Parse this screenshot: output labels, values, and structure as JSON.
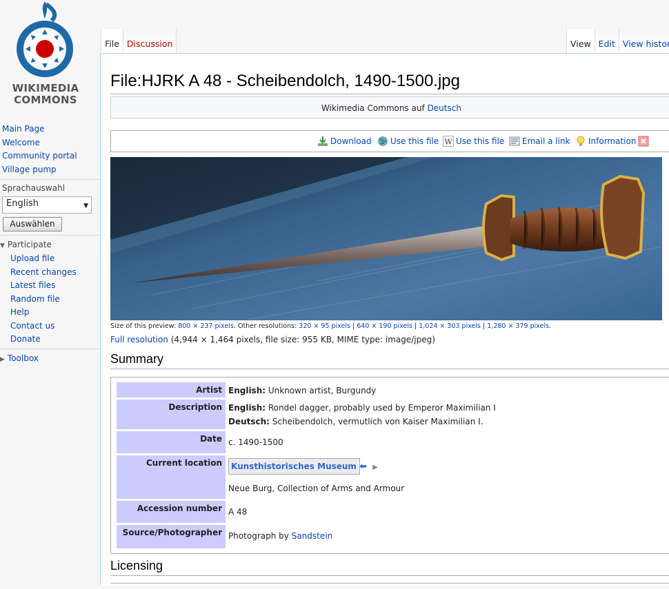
{
  "sidebar": {
    "logo_line1": "WIKIMEDIA",
    "logo_line2": "COMMONS",
    "nav": [
      "Main Page",
      "Welcome",
      "Community portal",
      "Village pump"
    ],
    "language_label": "Sprachauswahl",
    "language_selected": "English",
    "language_button": "Auswählen",
    "participate_label": "Participate",
    "participate_items": [
      "Upload file",
      "Recent changes",
      "Latest files",
      "Random file",
      "Help",
      "Contact us",
      "Donate"
    ],
    "toolbox_label": "Toolbox"
  },
  "tabs": {
    "left": [
      "File",
      "Discussion"
    ],
    "right": [
      "View",
      "Edit",
      "View histor"
    ]
  },
  "page": {
    "title": "File:HJRK A 48 - Scheibendolch, 1490-1500.jpg",
    "commons_prefix": "Wikimedia Commons auf ",
    "commons_link": "Deutsch"
  },
  "toolbar": {
    "download": "Download",
    "use_file_1": "Use this file",
    "use_file_2": "Use this file",
    "email": "Email a link",
    "information": "Information"
  },
  "image_info": {
    "size_prefix": "Size of this preview: ",
    "size_preview": "800 × 237 pixels",
    "other_label": ". Other resolutions: ",
    "res": [
      "320 × 95 pixels",
      "640 × 190 pixels",
      "1,024 × 303 pixels",
      "1,280 × 379 pixels"
    ],
    "full_res_link": "Full resolution",
    "full_res_details": " (4,944 × 1,464 pixels, file size: 955 KB, MIME type: image/jpeg)"
  },
  "summary": {
    "heading": "Summary",
    "artist_label": "Artist",
    "artist_lang": "English:",
    "artist_value": " Unknown artist, Burgundy",
    "description_label": "Description",
    "desc_en_lang": "English:",
    "desc_en": " Rondel dagger, probably used by Emperor Maximilian I",
    "desc_de_lang": "Deutsch:",
    "desc_de": " Scheibendolch, vermutlich von Kaiser Maximilian I.",
    "date_label": "Date",
    "date_value": "c. 1490-1500",
    "location_label": "Current location",
    "museum": "Kunsthistorisches Museum",
    "location_sub": "Neue Burg, Collection of Arms and Armour",
    "accession_label": "Accession number",
    "accession_value": "A 48",
    "source_label": "Source/Photographer",
    "source_prefix": "Photograph by ",
    "source_link": "Sandstein"
  },
  "licensing": {
    "heading": "Licensing"
  },
  "colors": {
    "link": "#0645ad",
    "label_bg": "#ccccff",
    "tab_border": "#a7d7f9",
    "red_link": "#ba0000"
  }
}
